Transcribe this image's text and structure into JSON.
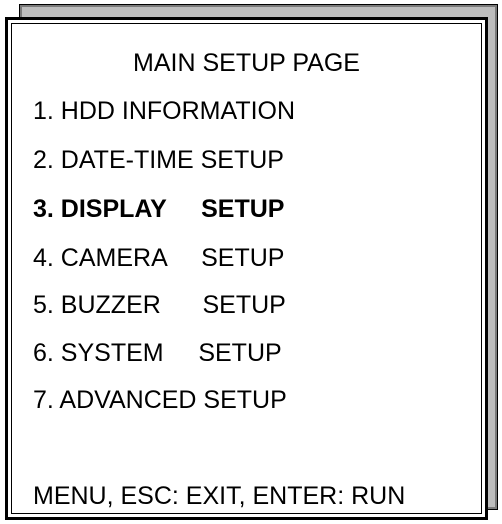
{
  "screen": {
    "title": "MAIN SETUP PAGE",
    "menu_items": [
      {
        "label": "1. HDD INFORMATION",
        "selected": false
      },
      {
        "label": "2. DATE-TIME SETUP",
        "selected": false
      },
      {
        "label": "3. DISPLAY     SETUP",
        "selected": true
      },
      {
        "label": "4. CAMERA     SETUP",
        "selected": false
      },
      {
        "label": "5. BUZZER      SETUP",
        "selected": false
      },
      {
        "label": "6. SYSTEM     SETUP",
        "selected": false
      },
      {
        "label": "7. ADVANCED SETUP",
        "selected": false
      }
    ],
    "footer_hint": "MENU, ESC: EXIT, ENTER: RUN"
  },
  "colors": {
    "background": "#ffffff",
    "text": "#000000",
    "shadow_dark": "#7a7a7a",
    "shadow_light": "#bdbdbd"
  }
}
